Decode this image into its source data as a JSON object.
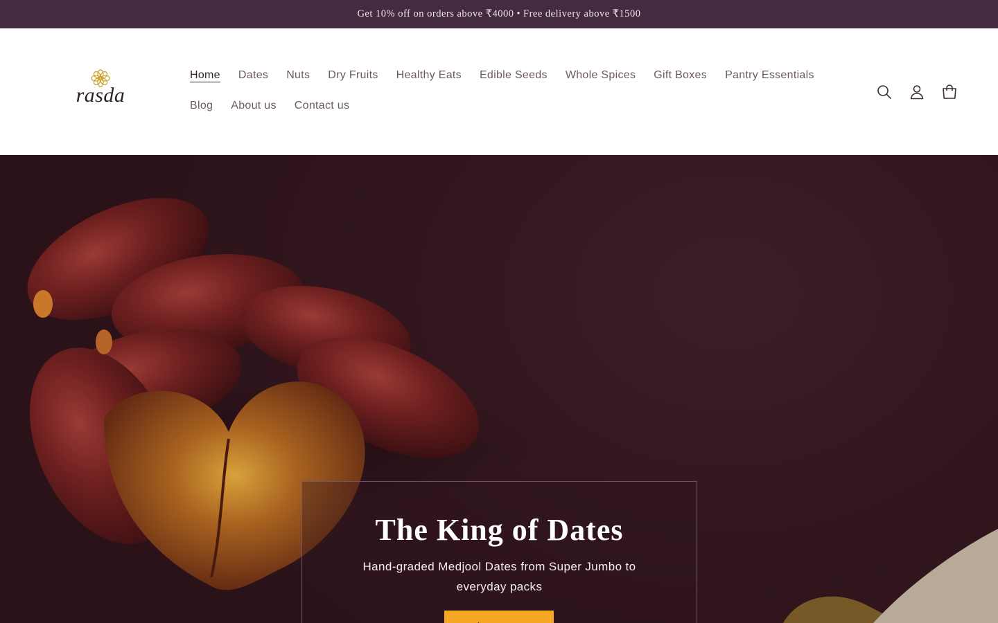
{
  "announcement": {
    "offer": "Get 10% off on orders above ₹4000",
    "separator": "•",
    "delivery": "Free delivery above ₹1500"
  },
  "brand": {
    "name": "rasda",
    "logo_icon": "flower-icon",
    "logo_color": "#c9a227"
  },
  "nav": {
    "items": [
      {
        "label": "Home",
        "active": true
      },
      {
        "label": "Dates"
      },
      {
        "label": "Nuts"
      },
      {
        "label": "Dry Fruits"
      },
      {
        "label": "Healthy Eats"
      },
      {
        "label": "Edible Seeds"
      },
      {
        "label": "Whole Spices"
      },
      {
        "label": "Gift Boxes"
      },
      {
        "label": "Pantry Essentials"
      },
      {
        "label": "Blog"
      },
      {
        "label": "About us"
      },
      {
        "label": "Contact us"
      }
    ]
  },
  "header_icons": [
    "search-icon",
    "account-icon",
    "cart-icon"
  ],
  "hero": {
    "title": "The King of Dates",
    "subtitle": "Hand-graded Medjool Dates from Super Jumbo to everyday packs",
    "button_label": "Shop Dates"
  },
  "colors": {
    "announcement_bg": "#452b3f",
    "hero_bg": "#33171f",
    "button_bg": "#f5a623"
  }
}
